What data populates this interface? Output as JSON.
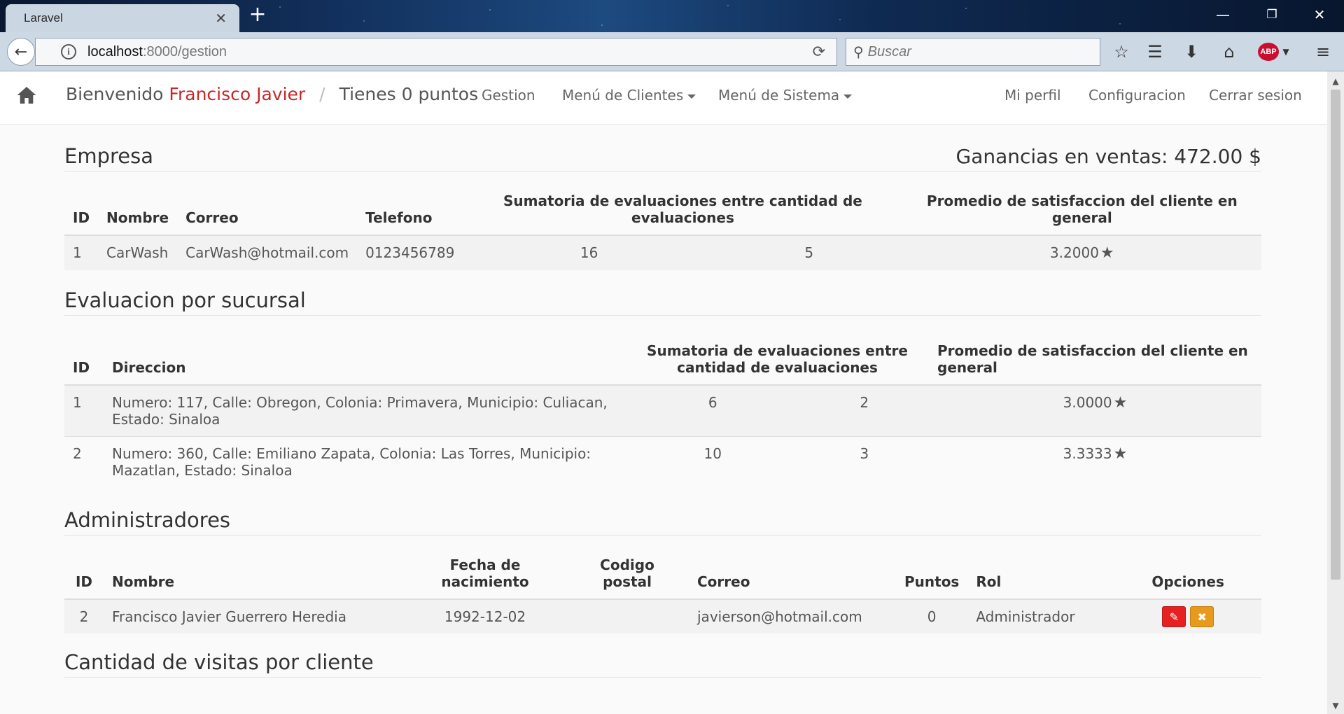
{
  "browser": {
    "tab_title": "Laravel",
    "url_host": "localhost",
    "url_path": ":8000/gestion",
    "search_placeholder": "Buscar"
  },
  "navbar": {
    "welcome": "Bienvenido",
    "user_name": "Francisco Javier",
    "points_text": "Tienes 0 puntos",
    "links": {
      "gestion": "Gestion",
      "menu_clientes": "Menú de Clientes",
      "menu_sistema": "Menú de Sistema",
      "mi_perfil": "Mi perfil",
      "configuracion": "Configuracion",
      "cerrar_sesion": "Cerrar sesion"
    }
  },
  "empresa": {
    "title": "Empresa",
    "earnings": "Ganancias en ventas: 472.00 $",
    "headers": {
      "id": "ID",
      "nombre": "Nombre",
      "correo": "Correo",
      "telefono": "Telefono",
      "sumatoria": "Sumatoria de evaluaciones entre cantidad de evaluaciones",
      "promedio": "Promedio de satisfaccion del cliente en general"
    },
    "rows": [
      {
        "id": "1",
        "nombre": "CarWash",
        "correo": "CarWash@hotmail.com",
        "telefono": "0123456789",
        "sumatoria": "16",
        "cantidad": "5",
        "promedio": "3.2000"
      }
    ]
  },
  "sucursales": {
    "title": "Evaluacion por sucursal",
    "headers": {
      "id": "ID",
      "direccion": "Direccion",
      "sumatoria": "Sumatoria de evaluaciones entre cantidad de evaluaciones",
      "promedio": "Promedio de satisfaccion del cliente en general"
    },
    "rows": [
      {
        "id": "1",
        "direccion": "Numero: 117, Calle: Obregon, Colonia: Primavera, Municipio: Culiacan, Estado: Sinaloa",
        "sumatoria": "6",
        "cantidad": "2",
        "promedio": "3.0000"
      },
      {
        "id": "2",
        "direccion": "Numero: 360, Calle: Emiliano Zapata, Colonia: Las Torres, Municipio: Mazatlan, Estado: Sinaloa",
        "sumatoria": "10",
        "cantidad": "3",
        "promedio": "3.3333"
      }
    ]
  },
  "administradores": {
    "title": "Administradores",
    "headers": {
      "id": "ID",
      "nombre": "Nombre",
      "fecha": "Fecha de nacimiento",
      "codigo_postal": "Codigo postal",
      "correo": "Correo",
      "puntos": "Puntos",
      "rol": "Rol",
      "opciones": "Opciones"
    },
    "rows": [
      {
        "id": "2",
        "nombre": "Francisco Javier Guerrero Heredia",
        "fecha": "1992-12-02",
        "codigo_postal": "",
        "correo": "javierson@hotmail.com",
        "puntos": "0",
        "rol": "Administrador"
      }
    ]
  },
  "visitas": {
    "title": "Cantidad de visitas por cliente"
  },
  "icons": {
    "star": "★",
    "edit": "✎",
    "delete": "✖"
  },
  "colors": {
    "user_name": "#c62828",
    "edit_button": "#e52121",
    "delete_button": "#e89a1c"
  }
}
